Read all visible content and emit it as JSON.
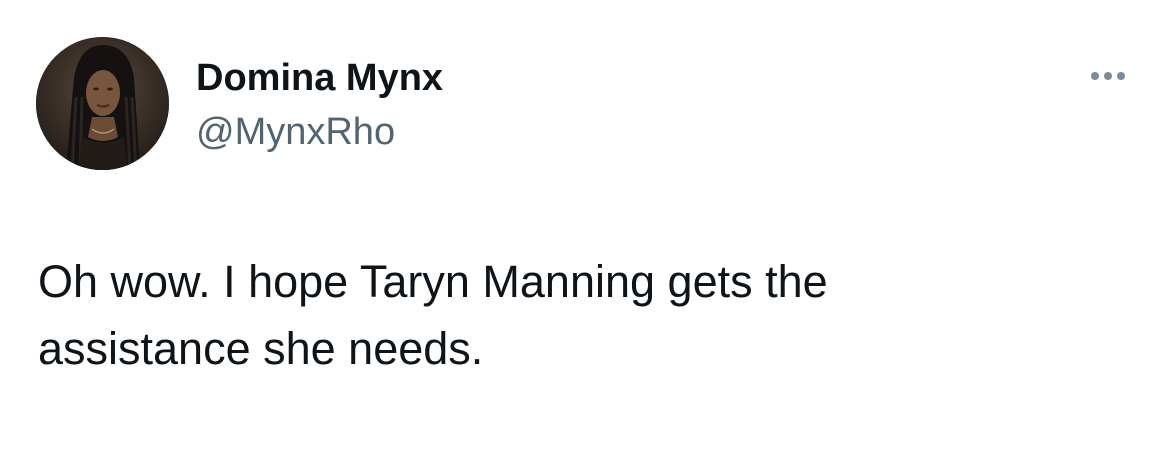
{
  "tweet": {
    "author": {
      "display_name": "Domina Mynx",
      "handle": "@MynxRho",
      "avatar_icon": "profile-photo"
    },
    "more_icon": "more-options-icon",
    "text": "Oh wow. I hope Taryn Manning gets the\nassistance she needs."
  },
  "colors": {
    "primary_text": "#0f1419",
    "secondary_text": "#536471",
    "background": "#ffffff"
  }
}
